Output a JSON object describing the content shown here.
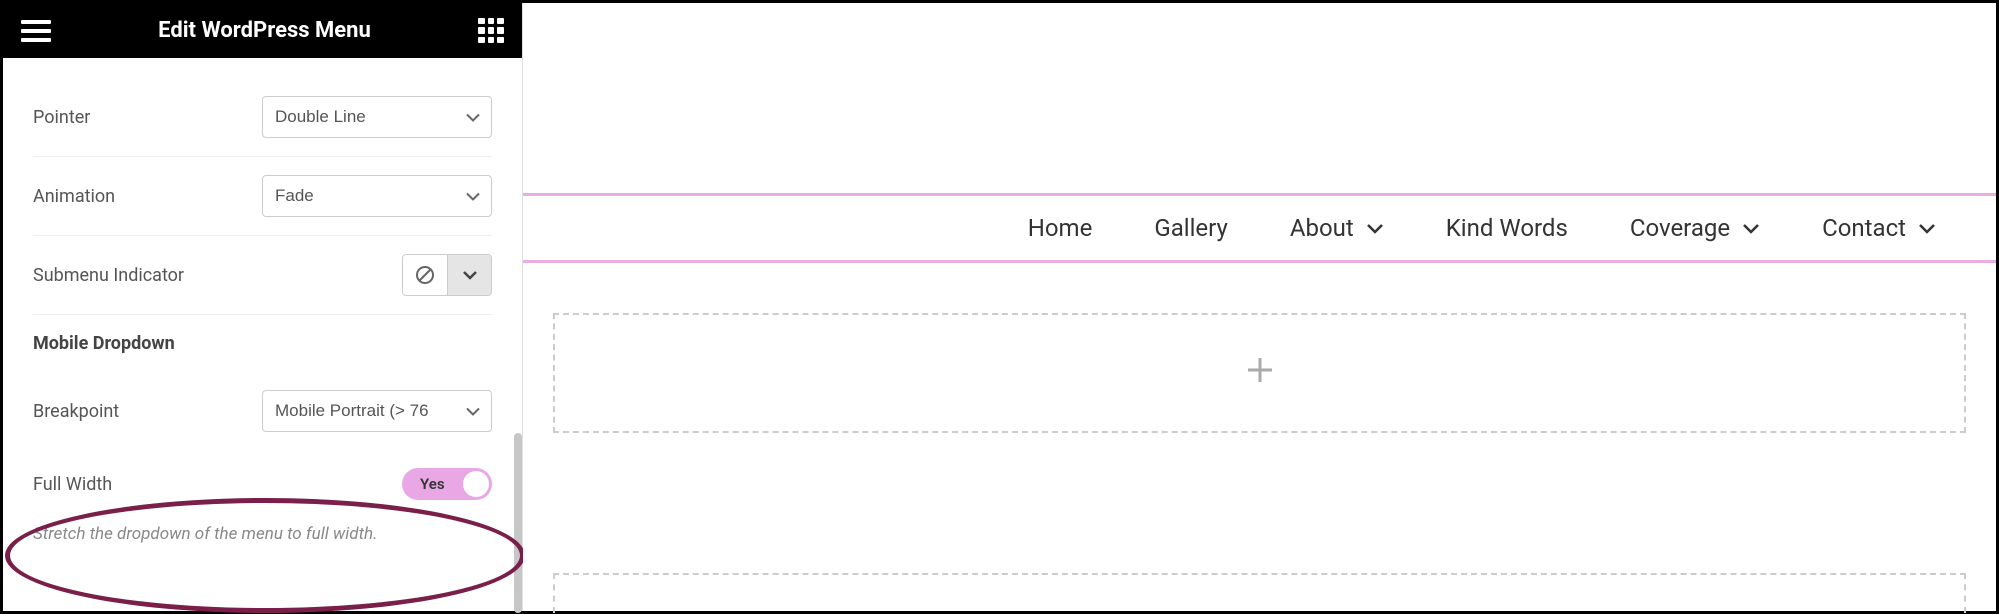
{
  "sidebar": {
    "title": "Edit WordPress Menu",
    "controls": {
      "pointer": {
        "label": "Pointer",
        "value": "Double Line"
      },
      "animation": {
        "label": "Animation",
        "value": "Fade"
      },
      "submenu_indicator": {
        "label": "Submenu Indicator"
      },
      "breakpoint": {
        "label": "Breakpoint",
        "value": "Mobile Portrait (> 76"
      },
      "full_width": {
        "label": "Full Width",
        "value": "Yes",
        "help": "Stretch the dropdown of the menu to full width."
      }
    },
    "section_label": "Mobile Dropdown"
  },
  "preview": {
    "nav": [
      {
        "label": "Home",
        "has_submenu": false
      },
      {
        "label": "Gallery",
        "has_submenu": false
      },
      {
        "label": "About",
        "has_submenu": true
      },
      {
        "label": "Kind Words",
        "has_submenu": false
      },
      {
        "label": "Coverage",
        "has_submenu": true
      },
      {
        "label": "Contact",
        "has_submenu": true
      }
    ]
  }
}
